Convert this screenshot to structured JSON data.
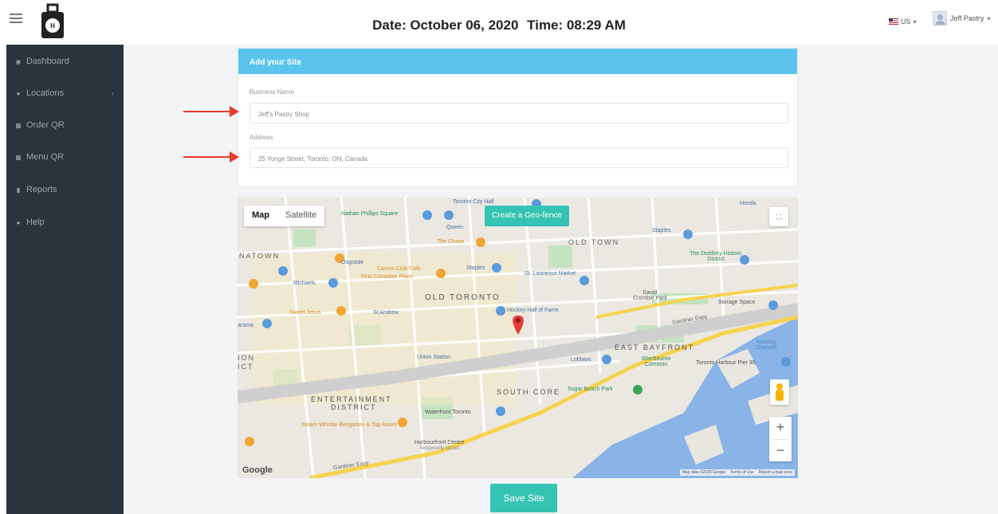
{
  "header": {
    "date_text": "Date: October 06, 2020",
    "time_text": "Time: 08:29 AM",
    "language": "US",
    "user_name": "Jeff Pastry"
  },
  "sidebar": {
    "items": [
      {
        "label": "Dashboard",
        "icon": "dashboard-icon"
      },
      {
        "label": "Locations",
        "icon": "map-marker-icon"
      },
      {
        "label": "Order QR",
        "icon": "qr-code-icon"
      },
      {
        "label": "Menu QR",
        "icon": "qr-code-icon"
      },
      {
        "label": "Reports",
        "icon": "file-icon"
      },
      {
        "label": "Help",
        "icon": "question-icon"
      }
    ]
  },
  "form": {
    "title": "Add your Site",
    "business_name_label": "Business Name",
    "business_name_value": "Jeff's Pastry Shop",
    "address_label": "Address",
    "address_value": "25 Yonge Street, Toronto, ON, Canada"
  },
  "map": {
    "type_buttons": [
      "Map",
      "Satellite"
    ],
    "selected_type": "Map",
    "geofence_button": "Create a Geo-fence",
    "footer": [
      "Map data ©2020 Google",
      "Terms of Use",
      "Report a map error"
    ],
    "logo": "Google",
    "labels": {
      "old_town": "OLD TOWN",
      "old_toronto": "OLD TORONTO",
      "east_bayfront": "EAST BAYFRONT",
      "south_core": "SOUTH CORE",
      "entertainment": "ENTERTAINMENT",
      "district": "DISTRICT",
      "natown": "NATOWN",
      "ion": "ION",
      "ict": "ICT",
      "arama": "arama",
      "nathan_phillips": "Nathan Phillips Square",
      "city_hall": "Toronto City Hall",
      "queen": "Queen",
      "osgoode": "Osgoode",
      "the_chase": "The Chase",
      "staples_1": "Staples",
      "staples_2": "Staples",
      "cactus_club": "Cactus Club Cafe",
      "first_canadian": "First Canadian Place",
      "st_lawrence": "St. Lawrence Market",
      "michaels": "Michaels",
      "sweet_jesus": "Sweet Jesus",
      "st_andrew": "St Andrew",
      "hockey_hall": "Hockey Hall of Fame",
      "union_station": "Union Station",
      "loblaws": "Loblaws",
      "sherbourne": "Sherbourne Common",
      "david_crombie": "David Crombie Park",
      "storage_space": "Storage Space",
      "distillery": "The Distillery Historic District",
      "harbour_pier": "Toronto Harbour Pier 35",
      "keating": "Keating Channel",
      "sugar_beach": "Sugar Beach Park",
      "waterfront": "Waterfront Toronto",
      "steam_whistle": "Steam Whistle Biergarten & Tap Room",
      "harbourfront": "Harbourfront Centre",
      "harbourfront_status": "Temporarily closed",
      "gardiner_1": "Gardiner Expy",
      "gardiner_2": "Gardiner Expy",
      "honda": "Honda"
    }
  },
  "save_button": "Save Site",
  "colors": {
    "sidebar": "#2b343d",
    "panel_header": "#5bc4ec",
    "accent": "#35c3b3",
    "arrow": "#e8392a"
  }
}
